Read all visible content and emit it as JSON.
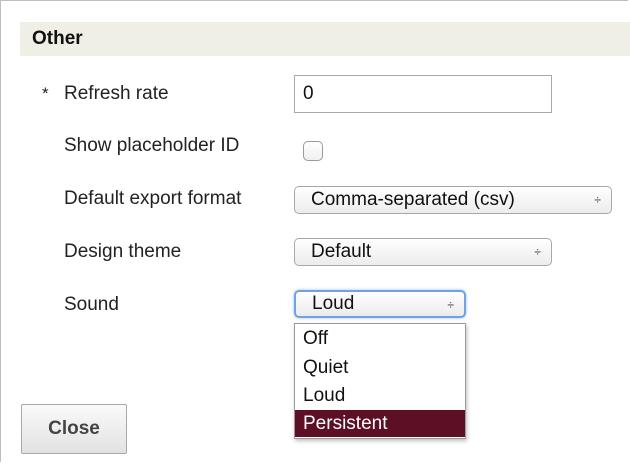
{
  "section": {
    "title": "Other"
  },
  "fields": {
    "refresh_rate": {
      "required_mark": "*",
      "label": "Refresh rate",
      "value": "0"
    },
    "show_placeholder_id": {
      "label": "Show placeholder ID",
      "checked": false
    },
    "default_export_format": {
      "label": "Default export format",
      "selected": "Comma-separated (csv)"
    },
    "design_theme": {
      "label": "Design theme",
      "selected": "Default"
    },
    "sound": {
      "label": "Sound",
      "selected": "Loud",
      "options": [
        "Off",
        "Quiet",
        "Loud",
        "Persistent"
      ],
      "highlighted": "Persistent"
    }
  },
  "select_arrows_glyph": "÷",
  "footer": {
    "close_label": "Close"
  },
  "colors": {
    "header_bg": "#efefe6",
    "highlight_bg": "#5c0f25",
    "focus_ring": "#6fa3e6"
  }
}
